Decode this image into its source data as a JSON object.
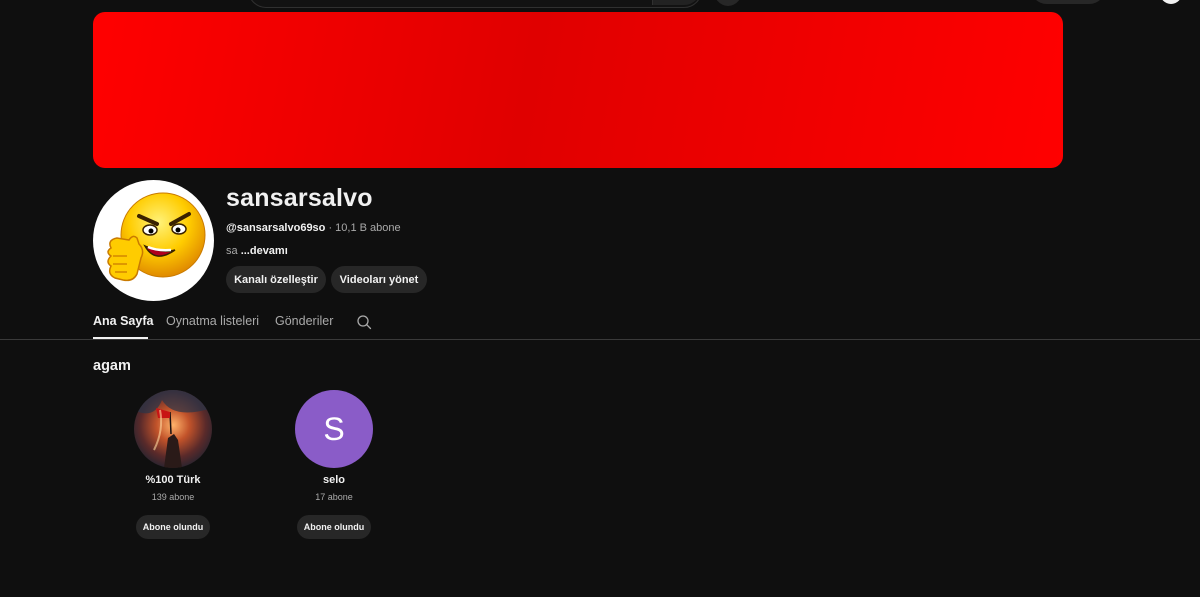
{
  "channel": {
    "name": "sansarsalvo",
    "handle": "@sansarsalvo69so",
    "subscribers": " · 10,1 B abone",
    "description": "sa ",
    "more_label": "...devamı",
    "avatar_icon": "angry-emoji-thumbs-up-avatar",
    "banner_color": "#ff0000"
  },
  "actions": {
    "customize_label": "Kanalı özelleştir",
    "manage_label": "Videoları yönet"
  },
  "tabs": [
    {
      "label": "Ana Sayfa",
      "active": true
    },
    {
      "label": "Oynatma listeleri",
      "active": false
    },
    {
      "label": "Gönderiler",
      "active": false
    }
  ],
  "tab_search_icon": "search-icon",
  "section": {
    "title": "agam",
    "channels": [
      {
        "name": "%100 Türk",
        "subs": "139 abone",
        "button": "Abone olundu",
        "avatar": "nebula-flag-image"
      },
      {
        "name": "selo",
        "subs": "17 abone",
        "button": "Abone olundu",
        "avatar_letter": "S",
        "avatar_color": "#8a5cc8"
      }
    ]
  }
}
